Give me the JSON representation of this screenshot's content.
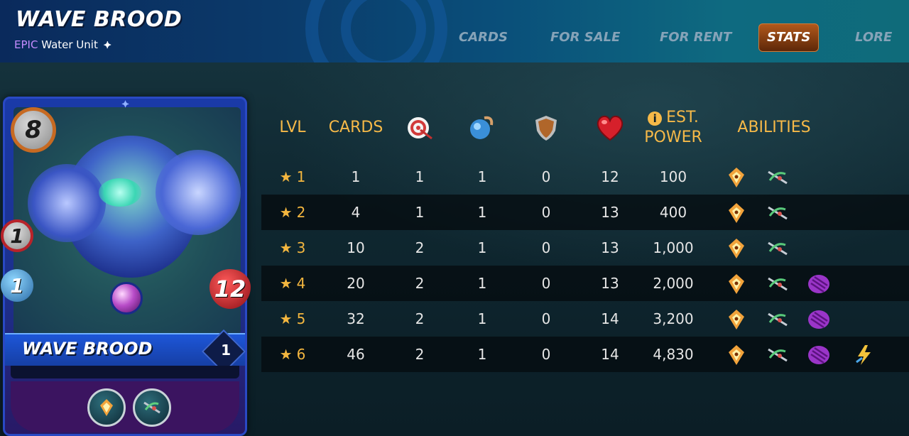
{
  "header": {
    "title": "WAVE BROOD",
    "rarity": "EPIC",
    "unit_type": "Water Unit"
  },
  "tabs": [
    {
      "label": "CARDS",
      "active": false
    },
    {
      "label": "FOR SALE",
      "active": false
    },
    {
      "label": "FOR RENT",
      "active": false
    },
    {
      "label": "STATS",
      "active": true
    },
    {
      "label": "LORE",
      "active": false
    }
  ],
  "card": {
    "name": "WAVE BROOD",
    "mana": "8",
    "attack": "1",
    "speed": "1",
    "health": "12",
    "level": "1",
    "abilities": [
      "divine-shield-icon",
      "reach-icon"
    ]
  },
  "table": {
    "headers": {
      "lvl": "LVL",
      "cards": "CARDS",
      "ranged": "ranged-attack-icon",
      "speed": "speed-icon",
      "armor": "armor-icon",
      "health": "health-icon",
      "power": "EST. POWER",
      "abilities": "ABILITIES"
    },
    "rows": [
      {
        "lvl": "1",
        "cards": "1",
        "ranged": "1",
        "speed": "1",
        "armor": "0",
        "health": "12",
        "power": "100",
        "abilities": 2
      },
      {
        "lvl": "2",
        "cards": "4",
        "ranged": "1",
        "speed": "1",
        "armor": "0",
        "health": "13",
        "power": "400",
        "abilities": 2
      },
      {
        "lvl": "3",
        "cards": "10",
        "ranged": "2",
        "speed": "1",
        "armor": "0",
        "health": "13",
        "power": "1,000",
        "abilities": 2
      },
      {
        "lvl": "4",
        "cards": "20",
        "ranged": "2",
        "speed": "1",
        "armor": "0",
        "health": "13",
        "power": "2,000",
        "abilities": 3
      },
      {
        "lvl": "5",
        "cards": "32",
        "ranged": "2",
        "speed": "1",
        "armor": "0",
        "health": "14",
        "power": "3,200",
        "abilities": 3
      },
      {
        "lvl": "6",
        "cards": "46",
        "ranged": "2",
        "speed": "1",
        "armor": "0",
        "health": "14",
        "power": "4,830",
        "abilities": 4
      }
    ]
  },
  "colors": {
    "accent": "#f6b948",
    "active_tab": "#9c4b16",
    "rarity": "#c48cff"
  }
}
